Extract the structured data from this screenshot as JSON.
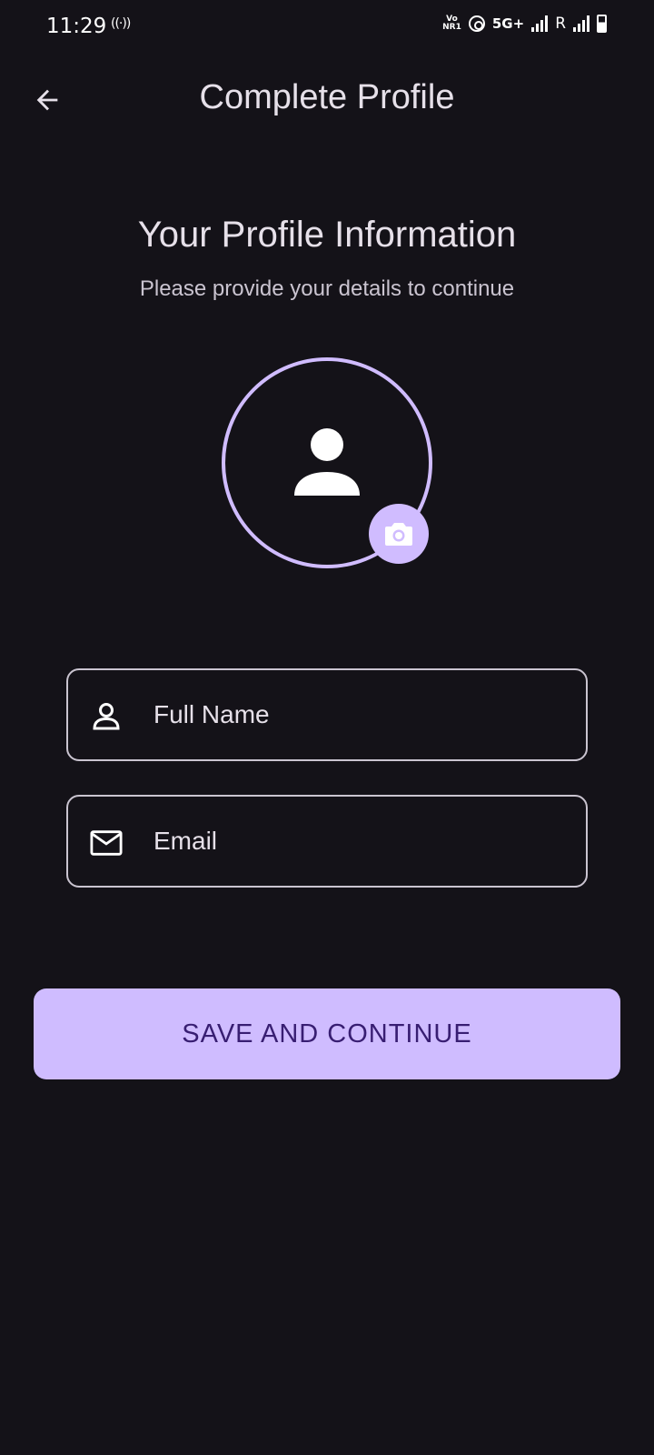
{
  "status_bar": {
    "time": "11:29",
    "hotspot": "((·))",
    "volte_top": "Vo",
    "volte_bottom": "NR1",
    "network": "5G+",
    "roaming": "R"
  },
  "app_bar": {
    "title": "Complete Profile",
    "back_icon": "arrow-back-icon"
  },
  "header": {
    "title": "Your Profile Information",
    "subtitle": "Please provide your details to continue"
  },
  "avatar": {
    "icon": "person-icon",
    "camera_icon": "camera-icon"
  },
  "form": {
    "name_placeholder": "Full Name",
    "name_value": "",
    "email_placeholder": "Email",
    "email_value": ""
  },
  "actions": {
    "save_label": "SAVE AND CONTINUE"
  },
  "colors": {
    "background": "#141218",
    "accent": "#D0BCFF",
    "button_text": "#381E72",
    "text": "#E6E0E9"
  }
}
